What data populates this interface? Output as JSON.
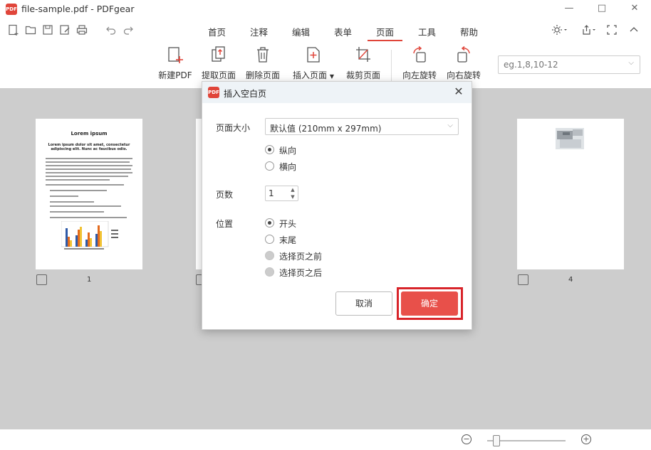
{
  "app": {
    "logo_text": "PDF",
    "title": "file-sample.pdf - PDFgear",
    "minimize": "—",
    "maximize": "□",
    "close": "✕"
  },
  "menu": {
    "tabs": [
      "首页",
      "注释",
      "编辑",
      "表单",
      "页面",
      "工具",
      "帮助"
    ],
    "active": "页面"
  },
  "quick_icons": [
    "new-file-icon",
    "open-folder-icon",
    "save-icon",
    "save-as-icon",
    "print-icon",
    "undo-icon",
    "redo-icon"
  ],
  "toolbar": {
    "tools": [
      "新建PDF",
      "提取页面",
      "删除页面",
      "插入页面",
      "裁剪页面",
      "向左旋转",
      "向右旋转"
    ],
    "page_range_placeholder": "eg.1,8,10-12"
  },
  "pages": {
    "page1_number": "1",
    "page4_number": "4",
    "doc_title": "Lorem ipsum",
    "doc_subtitle": "Lorem ipsum dolor sit amet, consectetur adipiscing elit. Nunc ac faucibus odio."
  },
  "dialog": {
    "title": "插入空白页",
    "size_label": "页面大小",
    "size_value": "默认值 (210mm x 297mm)",
    "orientation_options": [
      "纵向",
      "横向"
    ],
    "orientation_selected": "纵向",
    "count_label": "页数",
    "count_value": "1",
    "position_label": "位置",
    "position_options": [
      "开头",
      "末尾",
      "选择页之前",
      "选择页之后"
    ],
    "position_selected": "开头",
    "cancel_label": "取消",
    "ok_label": "确定"
  },
  "colors": {
    "accent": "#e0453a",
    "ok_button": "#e8504a",
    "highlight_frame": "#d8242a",
    "workspace_bg": "#cdcdcd"
  }
}
